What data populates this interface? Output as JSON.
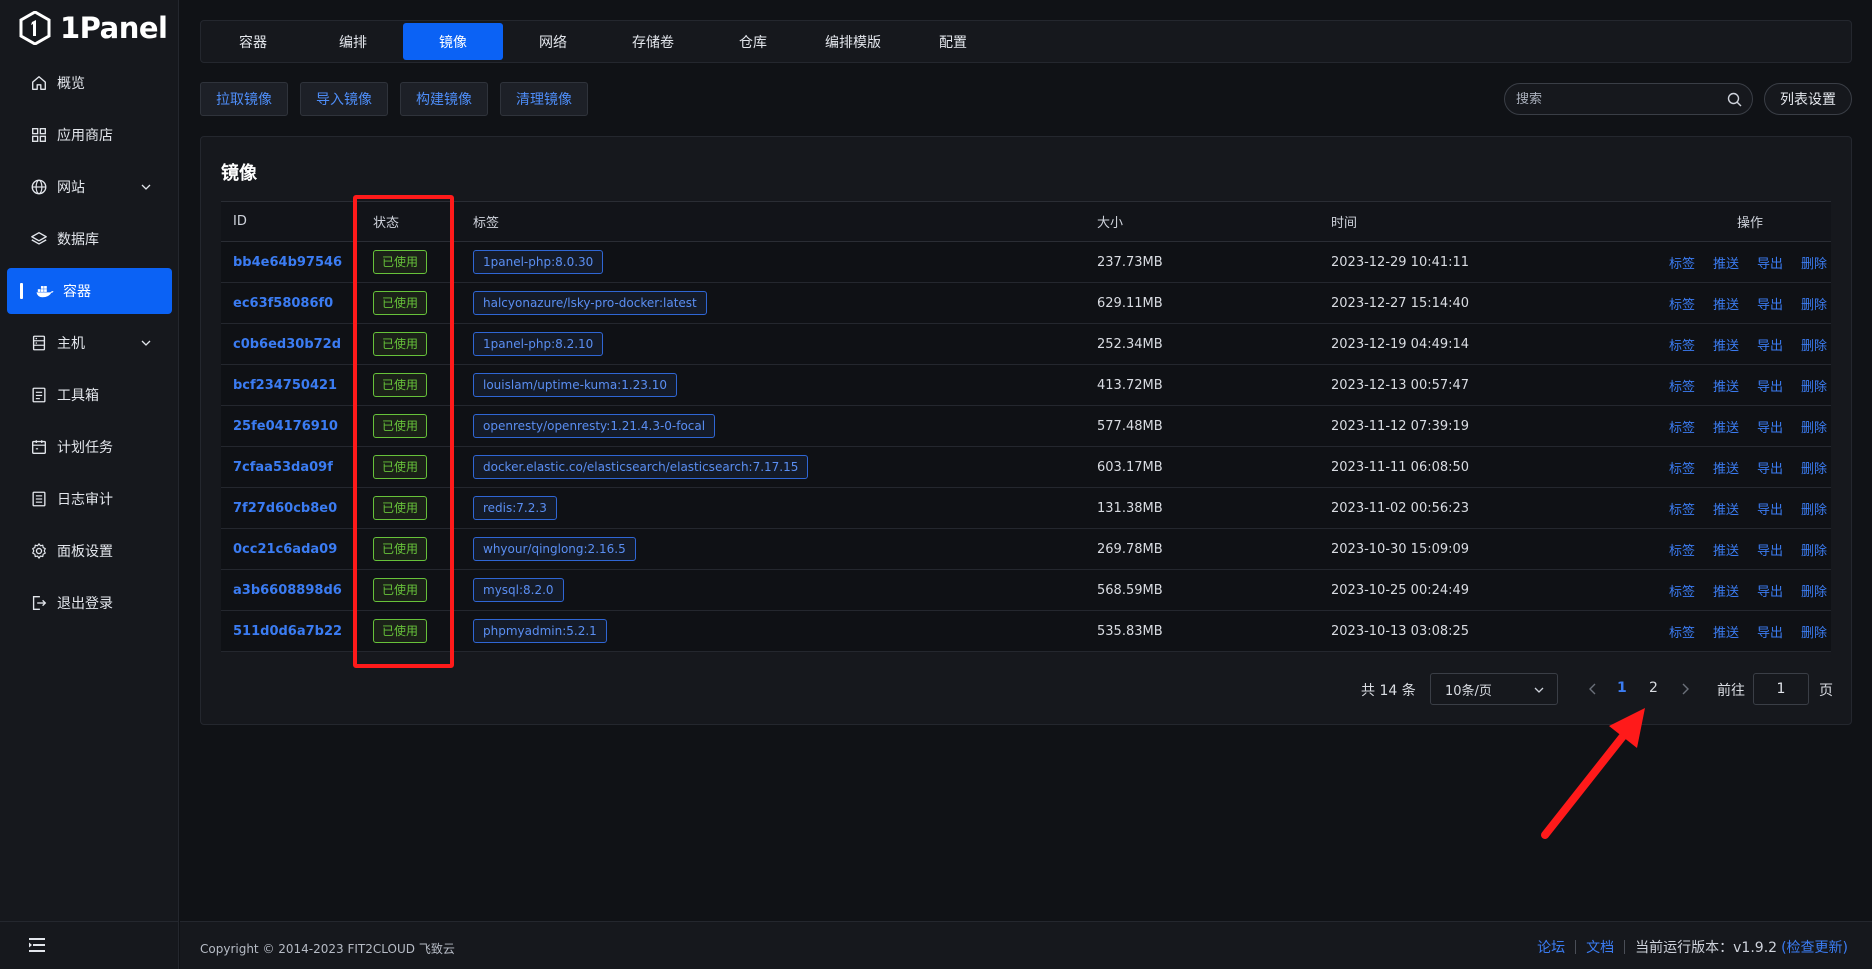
{
  "app": {
    "logo_text": "1Panel"
  },
  "sidebar": {
    "items": [
      {
        "label": "概览",
        "icon": "home-icon",
        "arrow": false,
        "active": false
      },
      {
        "label": "应用商店",
        "icon": "grid-icon",
        "arrow": false,
        "active": false
      },
      {
        "label": "网站",
        "icon": "globe-icon",
        "arrow": true,
        "active": false
      },
      {
        "label": "数据库",
        "icon": "layers-icon",
        "arrow": false,
        "active": false
      },
      {
        "label": "容器",
        "icon": "docker-icon",
        "arrow": false,
        "active": true
      },
      {
        "label": "主机",
        "icon": "server-icon",
        "arrow": true,
        "active": false
      },
      {
        "label": "工具箱",
        "icon": "toolbox-icon",
        "arrow": false,
        "active": false
      },
      {
        "label": "计划任务",
        "icon": "calendar-icon",
        "arrow": false,
        "active": false
      },
      {
        "label": "日志审计",
        "icon": "log-icon",
        "arrow": false,
        "active": false
      },
      {
        "label": "面板设置",
        "icon": "gear-icon",
        "arrow": false,
        "active": false
      },
      {
        "label": "退出登录",
        "icon": "logout-icon",
        "arrow": false,
        "active": false
      }
    ]
  },
  "tabs": [
    {
      "label": "容器",
      "active": false
    },
    {
      "label": "编排",
      "active": false
    },
    {
      "label": "镜像",
      "active": true
    },
    {
      "label": "网络",
      "active": false
    },
    {
      "label": "存储卷",
      "active": false
    },
    {
      "label": "仓库",
      "active": false
    },
    {
      "label": "编排模版",
      "active": false
    },
    {
      "label": "配置",
      "active": false
    }
  ],
  "toolbar": {
    "pull": "拉取镜像",
    "import": "导入镜像",
    "build": "构建镜像",
    "clean": "清理镜像",
    "search_placeholder": "搜索",
    "list_settings": "列表设置"
  },
  "card": {
    "title": "镜像"
  },
  "table": {
    "headers": {
      "id": "ID",
      "status": "状态",
      "tag": "标签",
      "size": "大小",
      "time": "时间",
      "ops": "操作"
    },
    "ops": [
      "标签",
      "推送",
      "导出",
      "删除"
    ],
    "rows": [
      {
        "id": "bb4e64b97546",
        "status": "已使用",
        "tag": "1panel-php:8.0.30",
        "size": "237.73MB",
        "time": "2023-12-29 10:41:11"
      },
      {
        "id": "ec63f58086f0",
        "status": "已使用",
        "tag": "halcyonazure/lsky-pro-docker:latest",
        "size": "629.11MB",
        "time": "2023-12-27 15:14:40"
      },
      {
        "id": "c0b6ed30b72d",
        "status": "已使用",
        "tag": "1panel-php:8.2.10",
        "size": "252.34MB",
        "time": "2023-12-19 04:49:14"
      },
      {
        "id": "bcf234750421",
        "status": "已使用",
        "tag": "louislam/uptime-kuma:1.23.10",
        "size": "413.72MB",
        "time": "2023-12-13 00:57:47"
      },
      {
        "id": "25fe04176910",
        "status": "已使用",
        "tag": "openresty/openresty:1.21.4.3-0-focal",
        "size": "577.48MB",
        "time": "2023-11-12 07:39:19"
      },
      {
        "id": "7cfaa53da09f",
        "status": "已使用",
        "tag": "docker.elastic.co/elasticsearch/elasticsearch:7.17.15",
        "size": "603.17MB",
        "time": "2023-11-11 06:08:50"
      },
      {
        "id": "7f27d60cb8e0",
        "status": "已使用",
        "tag": "redis:7.2.3",
        "size": "131.38MB",
        "time": "2023-11-02 00:56:23"
      },
      {
        "id": "0cc21c6ada09",
        "status": "已使用",
        "tag": "whyour/qinglong:2.16.5",
        "size": "269.78MB",
        "time": "2023-10-30 15:09:09"
      },
      {
        "id": "a3b6608898d6",
        "status": "已使用",
        "tag": "mysql:8.2.0",
        "size": "568.59MB",
        "time": "2023-10-25 00:24:49"
      },
      {
        "id": "511d0d6a7b22",
        "status": "已使用",
        "tag": "phpmyadmin:5.2.1",
        "size": "535.83MB",
        "time": "2023-10-13 03:08:25"
      }
    ]
  },
  "pagination": {
    "total": "共 14 条",
    "page_size": "10条/页",
    "pages": [
      "1",
      "2"
    ],
    "current": "1",
    "goto_label": "前往",
    "goto_value": "1",
    "page_label": "页"
  },
  "footer": {
    "copyright": "Copyright © 2014-2023 FIT2CLOUD 飞致云",
    "forum": "论坛",
    "docs": "文档",
    "version_label": "当前运行版本：v1.9.2",
    "check_update": "(检查更新)"
  },
  "colors": {
    "accent": "#0b62f5",
    "link": "#3b7cf2",
    "status_green": "#67c23a",
    "annotation_red": "#ff1a1a"
  }
}
